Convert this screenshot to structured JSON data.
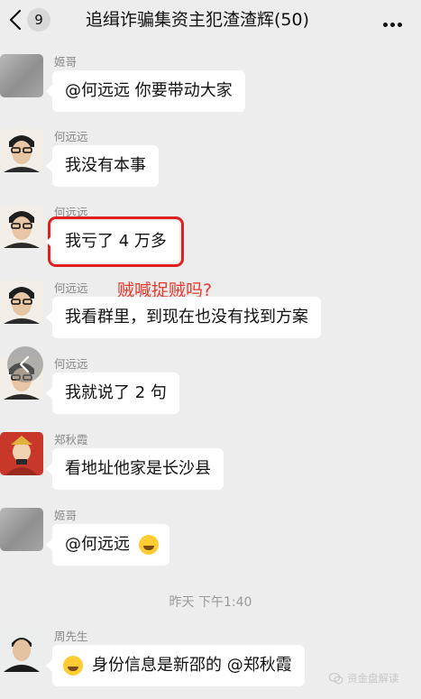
{
  "header": {
    "back_icon": "chevron-left-icon",
    "unread_count": "9",
    "title": "追缉诈骗集资主犯渣渣辉(50)",
    "more_icon": "more-dots-icon"
  },
  "messages": [
    {
      "sender": "姬哥",
      "text": "@何远远 你要带动大家"
    },
    {
      "sender": "何远远",
      "text": "我没有本事"
    },
    {
      "sender": "何远远",
      "text": "我亏了 4 万多"
    },
    {
      "sender": "何远远",
      "text": "我看群里，到现在也没有找到方案"
    },
    {
      "sender": "何远远",
      "text": "我就说了 2 句"
    },
    {
      "sender": "郑秋霞",
      "text": "看地址他家是长沙县"
    },
    {
      "sender": "姬哥",
      "text": "@何远远"
    },
    {
      "sender": "周先生",
      "text": "身份信息是新邵的 @郑秋霞"
    }
  ],
  "timestamp": "昨天 下午1:40",
  "annotation": "贼喊捉贼吗?",
  "watermark": "资金盘解读",
  "colors": {
    "background": "#ededed",
    "bubble": "#ffffff",
    "highlight_box": "#e02020",
    "annotation_text": "#e53a2c"
  }
}
